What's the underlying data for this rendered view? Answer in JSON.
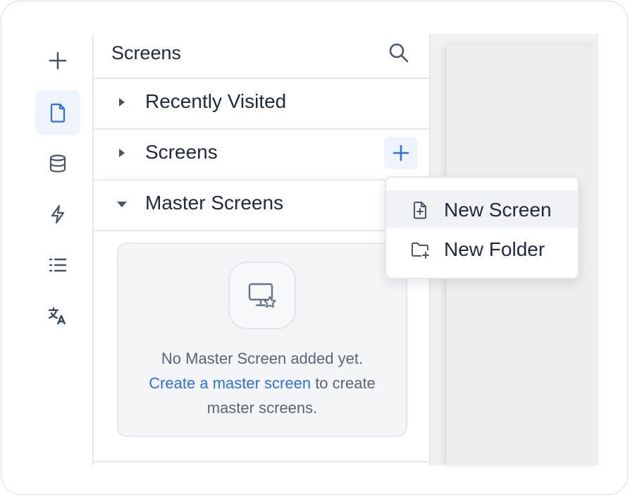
{
  "rail": {
    "items": [
      {
        "icon": "plus-icon"
      },
      {
        "icon": "page-icon",
        "active": true
      },
      {
        "icon": "database-icon"
      },
      {
        "icon": "lightning-icon"
      },
      {
        "icon": "list-icon"
      },
      {
        "icon": "translate-icon"
      }
    ]
  },
  "panel": {
    "title": "Screens",
    "search_icon": "search-icon",
    "sections": [
      {
        "label": "Recently Visited",
        "expanded": false
      },
      {
        "label": "Screens",
        "expanded": false
      },
      {
        "label": "Master Screens",
        "expanded": true
      }
    ],
    "empty": {
      "line1": "No Master Screen added yet.",
      "link": "Create a master screen",
      "line2_rest": " to create",
      "line3": "master screens."
    }
  },
  "menu": {
    "items": [
      {
        "label": "New Screen",
        "icon": "file-plus-icon"
      },
      {
        "label": "New Folder",
        "icon": "folder-plus-icon"
      }
    ]
  },
  "colors": {
    "accent": "#2f6fe4",
    "text": "#1e293b",
    "muted": "#5a6472",
    "border": "#e5e7eb"
  }
}
